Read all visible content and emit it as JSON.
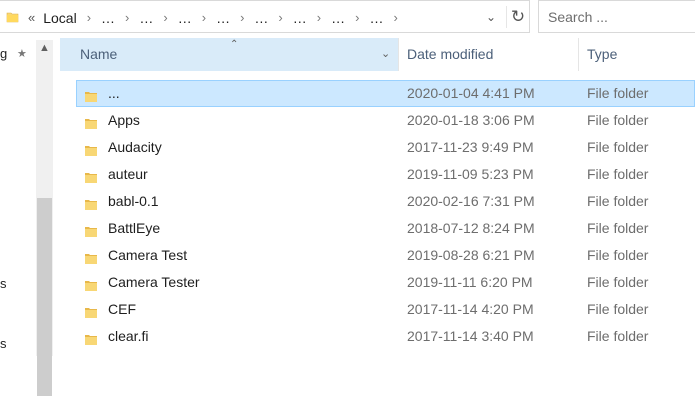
{
  "addressbar": {
    "prefix": "«",
    "segments": [
      "Local",
      "…",
      "…",
      "…",
      "…",
      "…",
      "…",
      "…",
      "…"
    ],
    "separator": "›",
    "dropdown_icon": "chevron-down-icon",
    "refresh_icon": "refresh-icon"
  },
  "search": {
    "placeholder": "Search ..."
  },
  "navpane": {
    "partial_labels": [
      "g",
      "s",
      "s"
    ]
  },
  "columns": {
    "name": "Name",
    "date": "Date modified",
    "type": "Type"
  },
  "files": [
    {
      "name": "...",
      "date": "2020-01-04 4:41 PM",
      "type": "File folder",
      "selected": true
    },
    {
      "name": "Apps",
      "date": "2020-01-18 3:06 PM",
      "type": "File folder"
    },
    {
      "name": "Audacity",
      "date": "2017-11-23 9:49 PM",
      "type": "File folder"
    },
    {
      "name": "auteur",
      "date": "2019-11-09 5:23 PM",
      "type": "File folder"
    },
    {
      "name": "babl-0.1",
      "date": "2020-02-16 7:31 PM",
      "type": "File folder"
    },
    {
      "name": "BattlEye",
      "date": "2018-07-12 8:24 PM",
      "type": "File folder"
    },
    {
      "name": "Camera Test",
      "date": "2019-08-28 6:21 PM",
      "type": "File folder"
    },
    {
      "name": "Camera Tester",
      "date": "2019-11-11 6:20 PM",
      "type": "File folder"
    },
    {
      "name": "CEF",
      "date": "2017-11-14 4:20 PM",
      "type": "File folder"
    },
    {
      "name": "clear.fi",
      "date": "2017-11-14 3:40 PM",
      "type": "File folder"
    }
  ],
  "colors": {
    "selection": "#cce8ff",
    "header_hover": "#d9ebf9",
    "folder": "#f8d775"
  }
}
